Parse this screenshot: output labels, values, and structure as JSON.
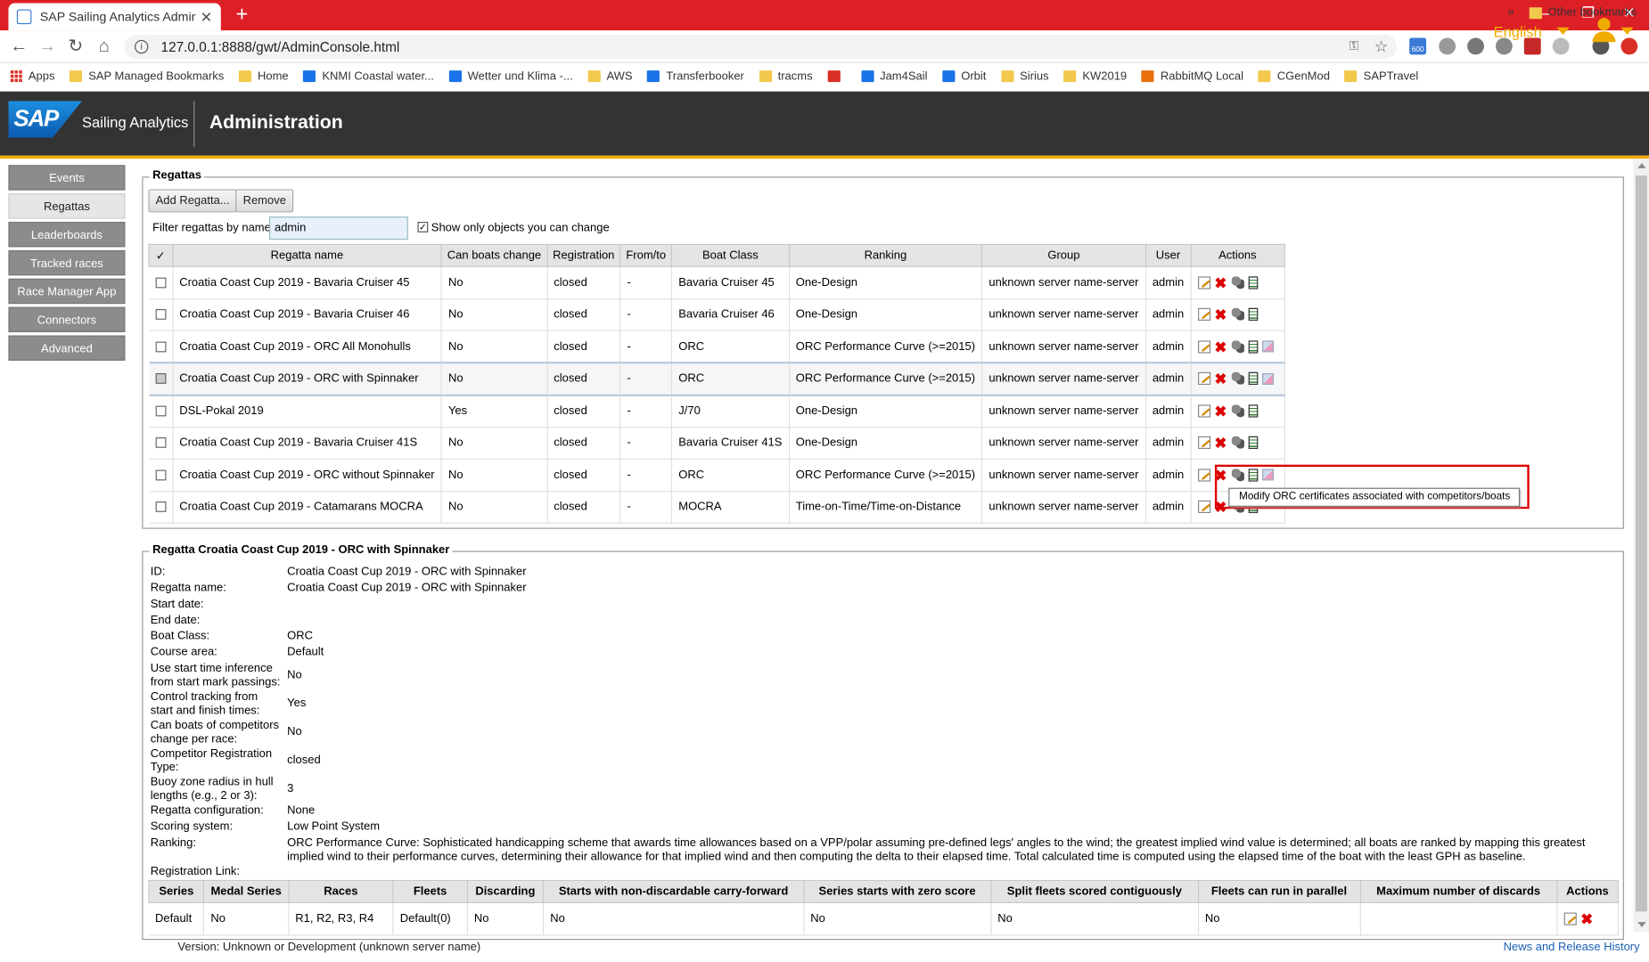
{
  "browser": {
    "tab_title": "SAP Sailing Analytics Administrat",
    "tab_close": "✕",
    "new_tab": "+",
    "url": "127.0.0.1:8888/gwt/AdminConsole.html",
    "bookmarks": [
      "Apps",
      "SAP Managed Bookmarks",
      "Home",
      "KNMI Coastal water...",
      "Wetter und Klima -...",
      "AWS",
      "Transferbooker",
      "tracms",
      "",
      "Jam4Sail",
      "Orbit",
      "Sirius",
      "KW2019",
      "RabbitMQ Local",
      "CGenMod",
      "SAPTravel"
    ],
    "bookmarks_more": "»",
    "other_bookmarks": "Other bookmarks",
    "ext_badge": "600"
  },
  "header": {
    "logo": "SAP",
    "brand": "Sailing Analytics",
    "title": "Administration",
    "language": "English"
  },
  "nav": [
    "Events",
    "Regattas",
    "Leaderboards",
    "Tracked races",
    "Race Manager App",
    "Connectors",
    "Advanced"
  ],
  "regattas": {
    "legend": "Regattas",
    "add_button": "Add Regatta...",
    "remove_button": "Remove",
    "filter_label": "Filter regattas by name:",
    "filter_value": "admin",
    "show_only_label": "Show only objects you can change",
    "columns": [
      "✓",
      "Regatta name",
      "Can boats change",
      "Registration",
      "From/to",
      "Boat Class",
      "Ranking",
      "Group",
      "User",
      "Actions"
    ],
    "rows": [
      [
        "Croatia Coast Cup 2019 - Bavaria Cruiser 45",
        "No",
        "closed",
        "-",
        "Bavaria Cruiser 45",
        "One-Design",
        "unknown server name-server",
        "admin"
      ],
      [
        "Croatia Coast Cup 2019 - Bavaria Cruiser 46",
        "No",
        "closed",
        "-",
        "Bavaria Cruiser 46",
        "One-Design",
        "unknown server name-server",
        "admin"
      ],
      [
        "Croatia Coast Cup 2019 - ORC All Monohulls",
        "No",
        "closed",
        "-",
        "ORC",
        "ORC Performance Curve (>=2015)",
        "unknown server name-server",
        "admin"
      ],
      [
        "Croatia Coast Cup 2019 - ORC with Spinnaker",
        "No",
        "closed",
        "-",
        "ORC",
        "ORC Performance Curve (>=2015)",
        "unknown server name-server",
        "admin"
      ],
      [
        "DSL-Pokal 2019",
        "Yes",
        "closed",
        "-",
        "J/70",
        "One-Design",
        "unknown server name-server",
        "admin"
      ],
      [
        "Croatia Coast Cup 2019 - Bavaria Cruiser 41S",
        "No",
        "closed",
        "-",
        "Bavaria Cruiser 41S",
        "One-Design",
        "unknown server name-server",
        "admin"
      ],
      [
        "Croatia Coast Cup 2019 - ORC without Spinnaker",
        "No",
        "closed",
        "-",
        "ORC",
        "ORC Performance Curve (>=2015)",
        "unknown server name-server",
        "admin"
      ],
      [
        "Croatia Coast Cup 2019 - Catamarans MOCRA",
        "No",
        "closed",
        "-",
        "MOCRA",
        "Time-on-Time/Time-on-Distance",
        "unknown server name-server",
        "admin"
      ]
    ],
    "tooltip": "Modify ORC certificates associated with competitors/boats"
  },
  "detail": {
    "legend": "Regatta Croatia Coast Cup 2019 - ORC with Spinnaker",
    "fields": [
      [
        "ID:",
        "Croatia Coast Cup 2019 - ORC with Spinnaker"
      ],
      [
        "Regatta name:",
        "Croatia Coast Cup 2019 - ORC with Spinnaker"
      ],
      [
        "Start date:",
        ""
      ],
      [
        "End date:",
        ""
      ],
      [
        "Boat Class:",
        "ORC"
      ],
      [
        "Course area:",
        "Default"
      ],
      [
        "Use start time inference from start mark passings:",
        "No"
      ],
      [
        "Control tracking from start and finish times:",
        "Yes"
      ],
      [
        "Can boats of competitors change per race:",
        "No"
      ],
      [
        "Competitor Registration Type:",
        "closed"
      ],
      [
        "Buoy zone radius in hull lengths (e.g., 2 or 3):",
        "3"
      ],
      [
        "Regatta configuration:",
        "None"
      ],
      [
        "Scoring system:",
        "Low Point System"
      ],
      [
        "Ranking:",
        "ORC Performance Curve: Sophisticated handicapping scheme that awards time allowances based on a VPP/polar assuming pre-defined legs' angles to the wind; the greatest implied wind value is determined; all boats are ranked by mapping this greatest implied wind to their performance curves, determining their allowance for that implied wind and then computing the delta to their elapsed time. Total calculated time is computed using the elapsed time of the boat with the least GPH as baseline."
      ],
      [
        "Registration Link:",
        ""
      ]
    ],
    "series_columns": [
      "Series",
      "Medal Series",
      "Races",
      "Fleets",
      "Discarding",
      "Starts with non-discardable carry-forward",
      "Series starts with zero score",
      "Split fleets scored contiguously",
      "Fleets can run in parallel",
      "Maximum number of discards",
      "Actions"
    ],
    "series_row": [
      "Default",
      "No",
      "R1, R2, R3, R4",
      "Default(0)",
      "No",
      "No",
      "No",
      "No",
      "No",
      ""
    ]
  },
  "footer": {
    "version": "Version: Unknown or Development (unknown server name)",
    "news": "News and Release History"
  }
}
